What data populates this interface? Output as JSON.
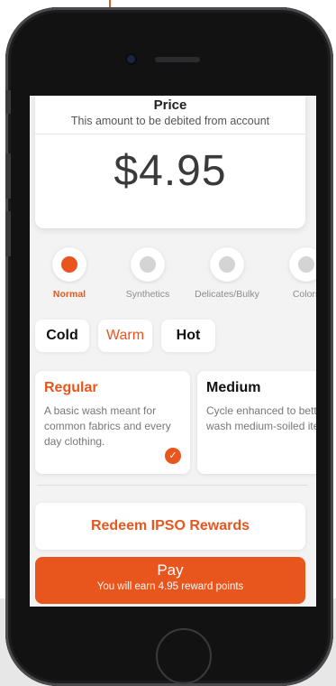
{
  "price": {
    "title": "Price",
    "subtitle": "This amount to be debited from account",
    "amount": "$4.95"
  },
  "cycles": [
    {
      "label": "Normal",
      "active": true
    },
    {
      "label": "Synthetics",
      "active": false
    },
    {
      "label": "Delicates/Bulky",
      "active": false
    },
    {
      "label": "Colors",
      "active": false
    }
  ],
  "temperatures": [
    {
      "label": "Cold",
      "selected": false
    },
    {
      "label": "Warm",
      "selected": true
    },
    {
      "label": "Hot",
      "selected": false
    }
  ],
  "wash_types": [
    {
      "title": "Regular",
      "description": "A basic wash meant for common fabrics and every day clothing.",
      "selected": true
    },
    {
      "title": "Medium",
      "description": "Cycle enhanced to better wash medium-soiled items",
      "selected": false
    }
  ],
  "actions": {
    "redeem_label": "Redeem IPSO Rewards",
    "pay_label": "Pay",
    "pay_sub": "You will earn 4.95 reward points"
  },
  "icons": {
    "selected_check": "check-icon"
  },
  "colors": {
    "accent": "#e8561d",
    "phone_body": "#121213",
    "screen_bg": "#f3f3f3"
  }
}
